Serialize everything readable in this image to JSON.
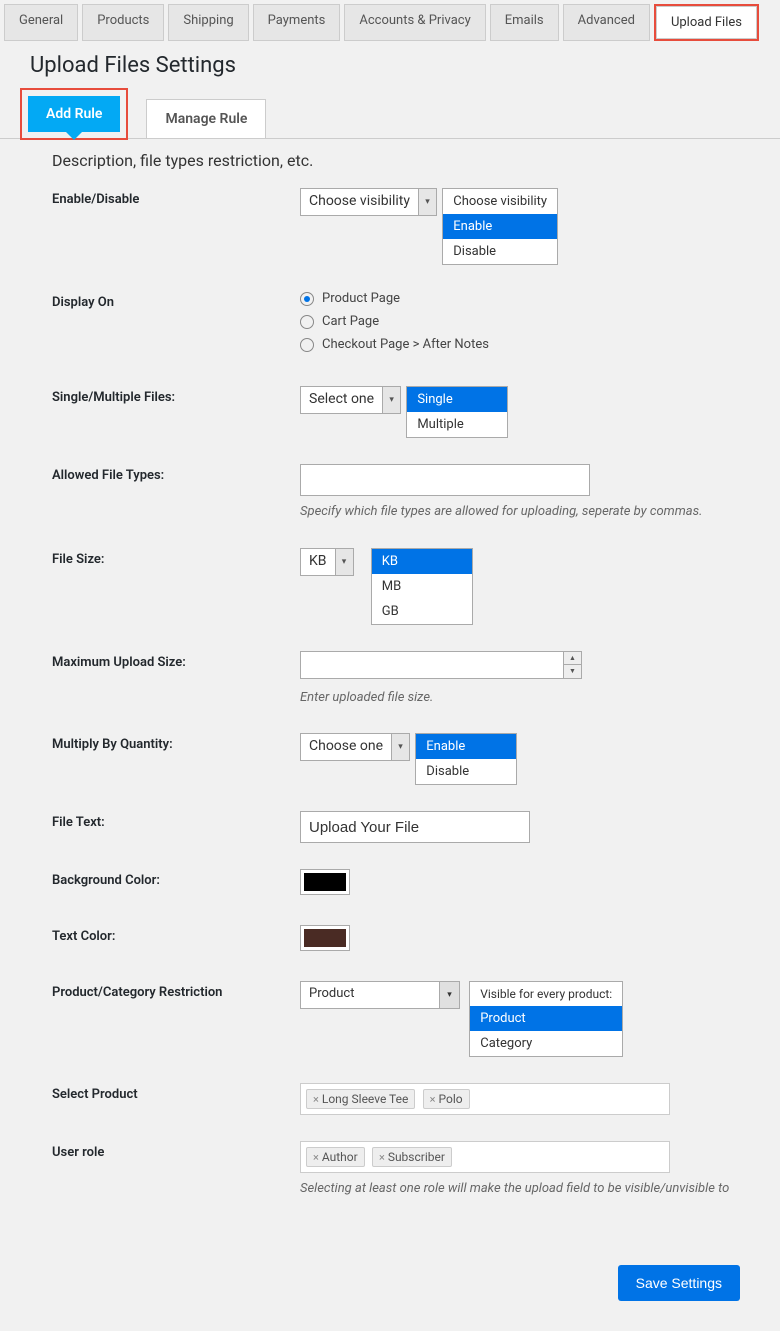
{
  "top_tabs": {
    "general": "General",
    "products": "Products",
    "shipping": "Shipping",
    "payments": "Payments",
    "accounts": "Accounts & Privacy",
    "emails": "Emails",
    "advanced": "Advanced",
    "upload_files": "Upload Files"
  },
  "page_title": "Upload Files Settings",
  "sub_tabs": {
    "add_rule": "Add Rule",
    "manage_rule": "Manage Rule"
  },
  "description": "Description, file types restriction, etc.",
  "labels": {
    "enable_disable": "Enable/Disable",
    "display_on": "Display On",
    "single_multiple": "Single/Multiple Files:",
    "allowed_types": "Allowed File Types:",
    "file_size": "File Size:",
    "max_upload": "Maximum Upload Size:",
    "multiply_qty": "Multiply By Quantity:",
    "file_text": "File Text:",
    "bg_color": "Background Color:",
    "text_color": "Text Color:",
    "restriction": "Product/Category Restriction",
    "select_product": "Select Product",
    "user_role": "User role"
  },
  "visibility": {
    "select_text": "Choose visibility",
    "opt_placeholder": "Choose visibility",
    "opt_enable": "Enable",
    "opt_disable": "Disable"
  },
  "display_on": {
    "product_page": "Product Page",
    "cart_page": "Cart Page",
    "checkout": "Checkout Page > After Notes"
  },
  "single_multiple": {
    "select_text": "Select one",
    "opt_single": "Single",
    "opt_multiple": "Multiple"
  },
  "allowed_types_helper": "Specify which file types are allowed for uploading, seperate by commas.",
  "file_size": {
    "select_text": "KB",
    "opt_kb": "KB",
    "opt_mb": "MB",
    "opt_gb": "GB"
  },
  "max_upload_helper": "Enter uploaded file size.",
  "multiply_qty": {
    "select_text": "Choose one",
    "opt_enable": "Enable",
    "opt_disable": "Disable"
  },
  "file_text_value": "Upload Your File",
  "colors": {
    "bg": "#000000",
    "text": "#4a2b24"
  },
  "restriction": {
    "select_text": "Product",
    "opt_every": "Visible for every product:",
    "opt_product": "Product",
    "opt_category": "Category"
  },
  "products": {
    "p1": "Long Sleeve Tee",
    "p2": "Polo"
  },
  "roles": {
    "r1": "Author",
    "r2": "Subscriber"
  },
  "roles_helper": "Selecting at least one role will make the upload field to be visible/unvisible to",
  "save_btn": "Save Settings"
}
